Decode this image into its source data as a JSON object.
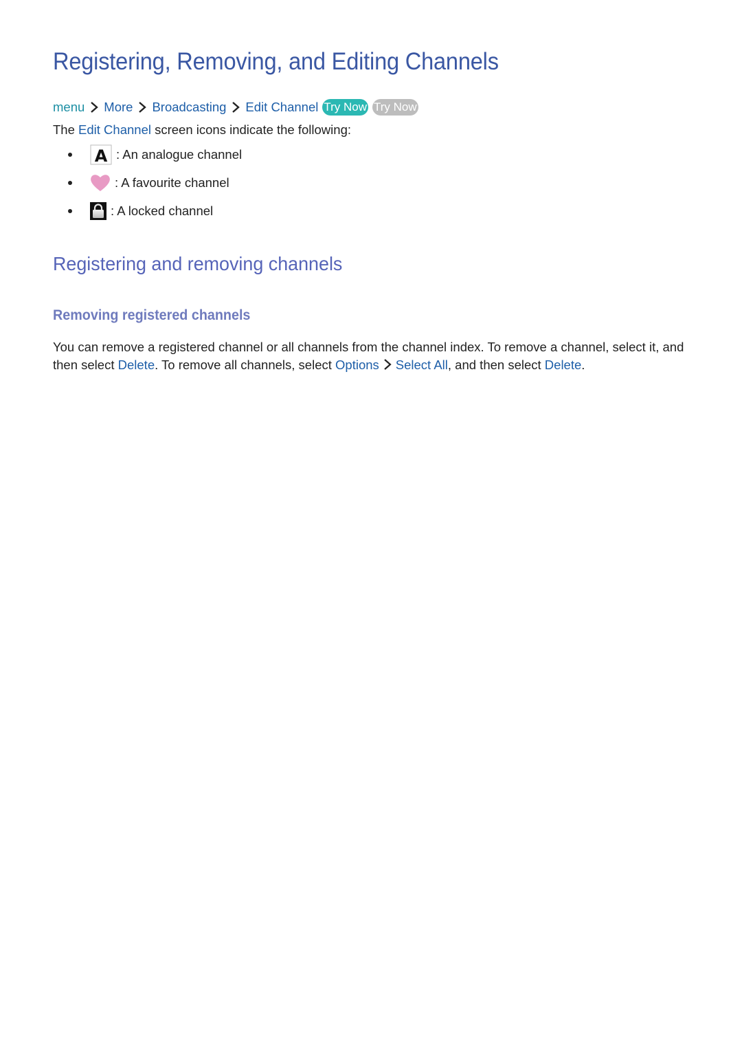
{
  "page": {
    "title": "Registering, Removing, and Editing Channels"
  },
  "breadcrumb": {
    "items": [
      "menu",
      "More",
      "Broadcasting",
      "Edit Channel"
    ],
    "try_now_active": "Try Now",
    "try_now_inactive": "Try Now"
  },
  "intro": {
    "prefix": "The ",
    "highlight": "Edit Channel",
    "suffix": " screen icons indicate the following:"
  },
  "icon_legend": [
    {
      "icon": "analogue-channel-icon",
      "text": ": An analogue channel"
    },
    {
      "icon": "heart-icon",
      "text": ": A favourite channel"
    },
    {
      "icon": "lock-icon",
      "text": ": A locked channel"
    }
  ],
  "section": {
    "title": "Registering and removing channels",
    "subsection_title": "Removing registered channels",
    "body": {
      "part1": "You can remove a registered channel or all channels from the channel index. To remove a channel, select it, and then select ",
      "delete1": "Delete",
      "part2": ". To remove all channels, select ",
      "options": "Options",
      "select_all": "Select All",
      "part3": ", and then select ",
      "delete2": "Delete",
      "part4": "."
    }
  },
  "colors": {
    "title": "#3a57a3",
    "link": "#1d5ea8",
    "menu_link": "#1b8ea3",
    "try_now_active": "#2bb8b3",
    "try_now_inactive": "#bdbdbd",
    "section_title": "#5664b8",
    "subsection_title": "#6f7bbd",
    "heart": "#e89ac4"
  }
}
